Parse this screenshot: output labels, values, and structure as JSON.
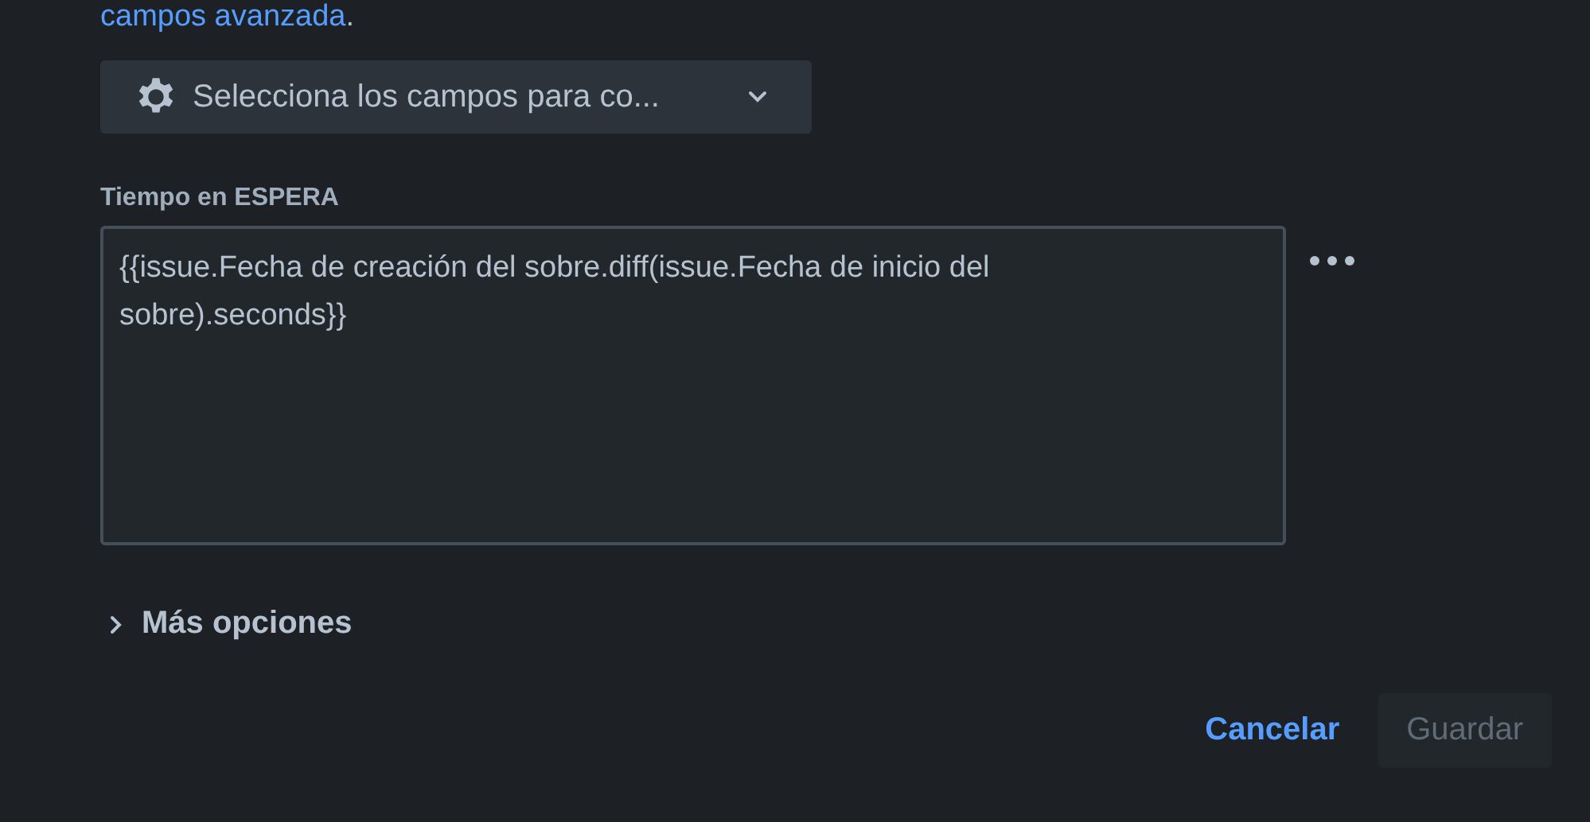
{
  "intro": {
    "link": "campos avanzada",
    "after": "."
  },
  "field_picker": {
    "label": "Selecciona los campos para co..."
  },
  "field": {
    "label": "Tiempo en ESPERA",
    "value": "{{issue.Fecha de creación del sobre.diff(issue.Fecha de inicio del sobre).seconds}}"
  },
  "more_options": {
    "label": "Más opciones",
    "expanded": false
  },
  "buttons": [
    {
      "kind": "link",
      "label": "Cancelar",
      "disabled": false
    },
    {
      "kind": "primary",
      "label": "Guardar",
      "disabled": true
    }
  ]
}
